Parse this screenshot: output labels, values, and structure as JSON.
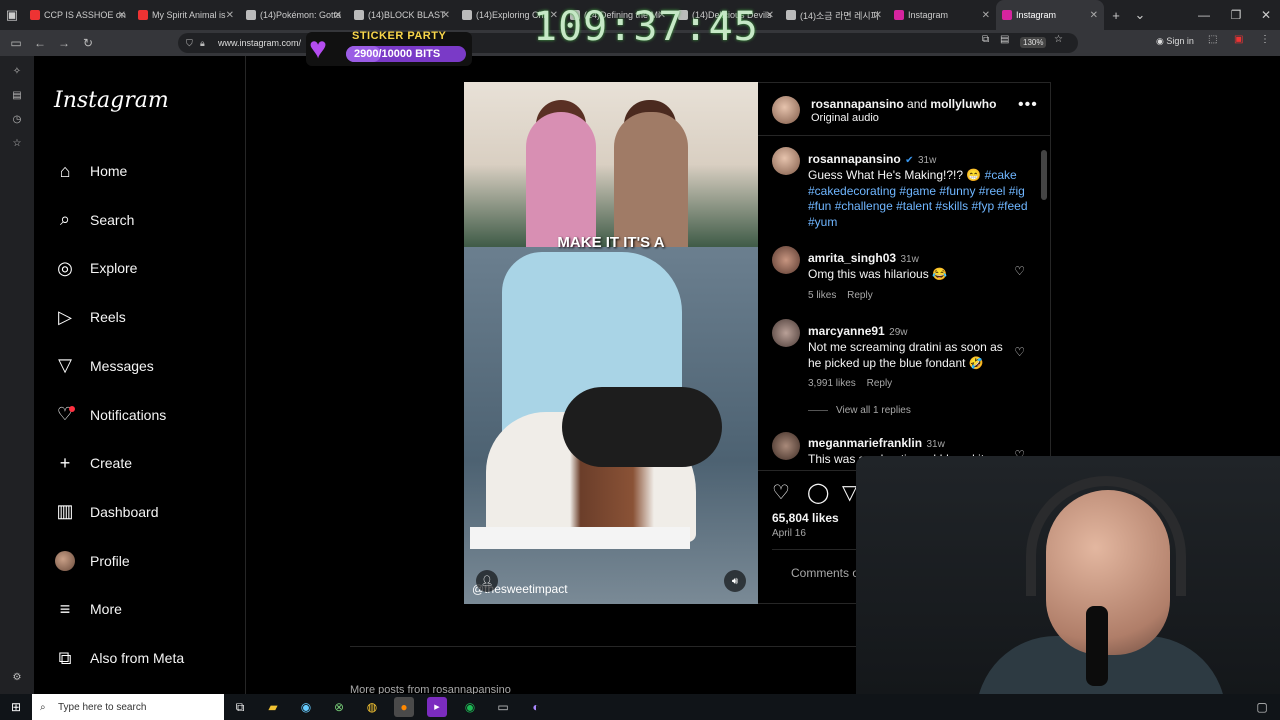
{
  "browser": {
    "tabs": [
      {
        "label": "CCP IS ASSHOE on",
        "color": "#e33"
      },
      {
        "label": "My Spirit Animal is",
        "color": "#e33"
      },
      {
        "label": "(14)Pokémon: Gotta",
        "color": "#bbb"
      },
      {
        "label": "(14)BLOCK BLAST",
        "color": "#bbb"
      },
      {
        "label": "(14)Exploring Chi",
        "color": "#bbb"
      },
      {
        "label": "(14)Defining the Mi",
        "color": "#bbb"
      },
      {
        "label": "(14)Delicious Devils",
        "color": "#bbb"
      },
      {
        "label": "(14)소금 라면 레시피",
        "color": "#bbb"
      },
      {
        "label": "Instagram",
        "color": "#d6249f"
      },
      {
        "label": "Instagram",
        "color": "#d6249f"
      }
    ],
    "url": "www.instagram.com/",
    "zoom": "130%",
    "signin": "Sign in"
  },
  "overlay": {
    "timer": "109:37:45",
    "sticker_title": "STICKER PARTY",
    "sticker_amount": "2900/10000 BITS",
    "sticker_progress": 0.29
  },
  "nav": {
    "logo": "Instagram",
    "items": [
      {
        "label": "Home",
        "icon": "house-icon"
      },
      {
        "label": "Search",
        "icon": "search-icon"
      },
      {
        "label": "Explore",
        "icon": "compass-icon"
      },
      {
        "label": "Reels",
        "icon": "reels-icon"
      },
      {
        "label": "Messages",
        "icon": "send-icon"
      },
      {
        "label": "Notifications",
        "icon": "heart-icon"
      },
      {
        "label": "Create",
        "icon": "plus-icon"
      },
      {
        "label": "Dashboard",
        "icon": "chart-icon"
      },
      {
        "label": "Profile",
        "icon": "avatar"
      },
      {
        "label": "More",
        "icon": "menu-icon"
      },
      {
        "label": "Also from Meta",
        "icon": "meta-icon"
      }
    ]
  },
  "video": {
    "caption_overlay": "MAKE IT IT'S A",
    "handle_overlay": "@thesweetimpact"
  },
  "post": {
    "author": "rosannapansino",
    "and_text": "and",
    "coauthor": "mollyluwho",
    "audio": "Original audio",
    "caption": {
      "user": "rosannapansino",
      "time": "31w",
      "text": "Guess What He's Making!?!? 😁",
      "tags": "#cake #cakedecorating #game #funny #reel #ig #fun #challenge #talent #skills #fyp #feed #yum"
    },
    "comments": [
      {
        "user": "amrita_singh03",
        "time": "31w",
        "text": "Omg this was hilarious 😂",
        "likes": "5 likes",
        "reply": "Reply"
      },
      {
        "user": "marcyanne91",
        "time": "29w",
        "text": "Not me screaming dratini as soon as he picked up the blue fondant 🤣",
        "likes": "3,991 likes",
        "reply": "Reply",
        "view_replies": "View all 1 replies"
      },
      {
        "user": "meganmariefranklin",
        "time": "31w",
        "text": "This was so chaotic and I loved it",
        "likes": "",
        "reply": ""
      }
    ],
    "likes": "65,804 likes",
    "date": "April 16",
    "comments_disabled": "Comments on this post have"
  },
  "footer": {
    "more_posts": "More posts from rosannapansino"
  },
  "taskbar": {
    "search_placeholder": "Type here to search"
  }
}
